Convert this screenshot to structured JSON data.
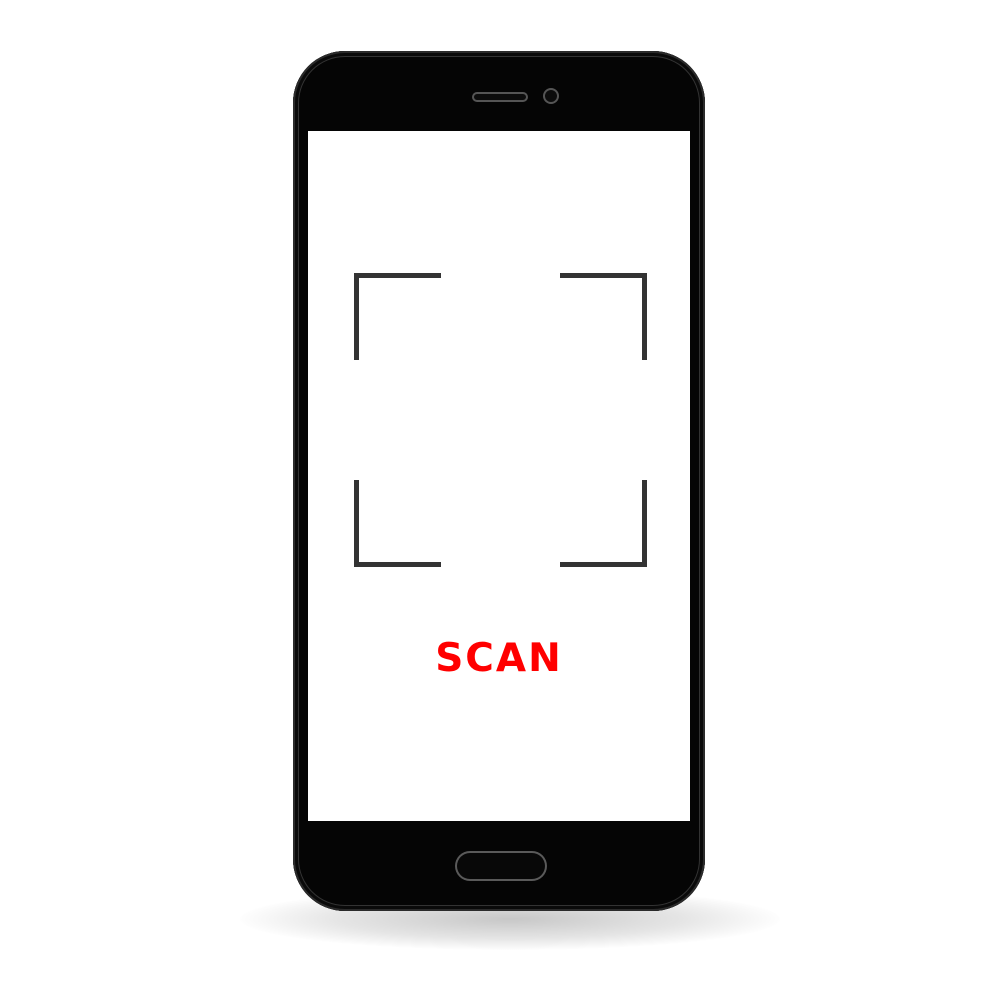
{
  "screen": {
    "label": "SCAN",
    "label_color": "#ff0000",
    "frame_color": "#333333"
  },
  "device": {
    "body_color": "#050505",
    "icons": [
      "earpiece-icon",
      "front-camera-icon",
      "home-button",
      "scan-frame-icon"
    ]
  }
}
